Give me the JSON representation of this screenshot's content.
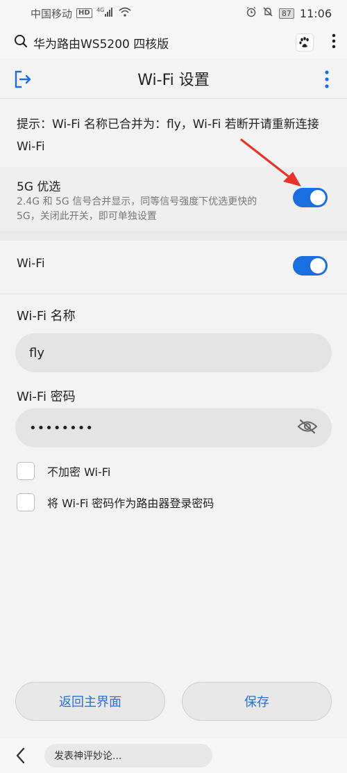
{
  "status_bar": {
    "carrier": "中国移动",
    "network_badge": "HD",
    "signal_label": "4G",
    "battery": "87",
    "time": "11:06"
  },
  "browser": {
    "query": "华为路由WS5200 四核版",
    "icons": [
      "search-icon",
      "baidu-paw-icon",
      "more-vertical-icon"
    ]
  },
  "header": {
    "title": "Wi-Fi 设置",
    "icons": [
      "exit-icon",
      "more-vertical-icon"
    ]
  },
  "tip": "提示：Wi-Fi 名称已合并为：fly，Wi-Fi 若断开请重新连接 Wi-Fi",
  "five_g": {
    "title": "5G 优选",
    "description": "2.4G 和 5G 信号合并显示，同等信号强度下优选更快的 5G，关闭此开关，即可单独设置",
    "enabled": true
  },
  "wifi": {
    "label": "Wi-Fi",
    "enabled": true
  },
  "name_field": {
    "label": "Wi-Fi 名称",
    "value": "fly"
  },
  "password_field": {
    "label": "Wi-Fi 密码",
    "value": "••••••••"
  },
  "options": [
    {
      "label": "不加密 Wi-Fi",
      "checked": false
    },
    {
      "label": "将 Wi-Fi 密码作为路由器登录密码",
      "checked": false
    }
  ],
  "buttons": {
    "back_label": "返回主界面",
    "save_label": "保存"
  },
  "bottom": {
    "comment_placeholder": "发表神评妙论..."
  },
  "colors": {
    "accent": "#1a6fe0",
    "button_text": "#2a6fd6",
    "annotation": "#e8332a"
  }
}
